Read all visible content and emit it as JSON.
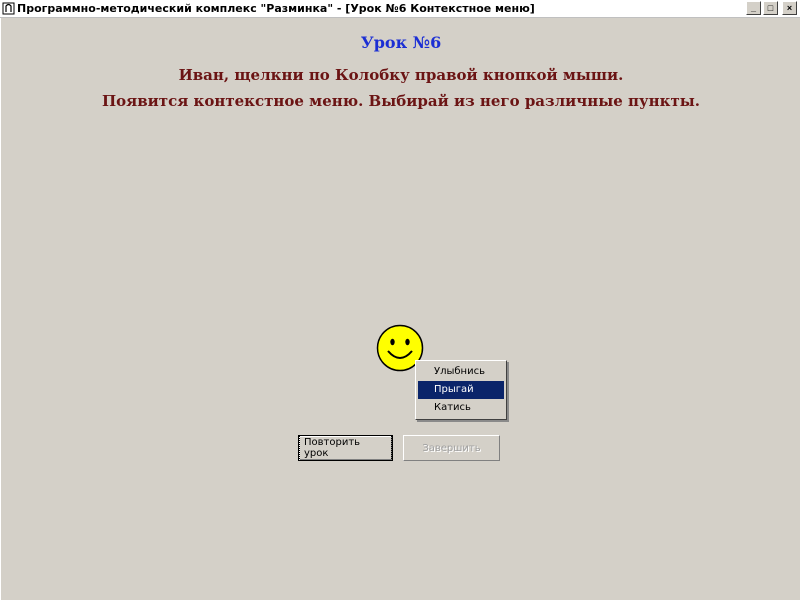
{
  "window": {
    "title": "Программно-методический комплекс \"Разминка\" - [Урок №6 Контекстное меню]",
    "buttons": {
      "minimize": "_",
      "maximize": "□",
      "close": "×"
    }
  },
  "lesson": {
    "title": "Урок №6",
    "instruction_line1": "Иван, щелкни по Колобку правой кнопкой мыши.",
    "instruction_line2": "Появится контекстное меню. Выбирай из него различные пункты."
  },
  "context_menu": {
    "items": [
      {
        "label": "Улыбнись",
        "selected": false
      },
      {
        "label": "Прыгай",
        "selected": true
      },
      {
        "label": "Катись",
        "selected": false
      }
    ]
  },
  "buttons": {
    "repeat_label": "Повторить урок",
    "finish_label": "Завершить"
  },
  "colors": {
    "background": "#d4d0c8",
    "lesson_title": "#1c2fd4",
    "instruction": "#6b1414",
    "menu_highlight": "#0a246a",
    "smiley_fill": "#ffff00"
  },
  "icons": {
    "app": "app-icon",
    "character": "kolobok-smiley-icon"
  }
}
